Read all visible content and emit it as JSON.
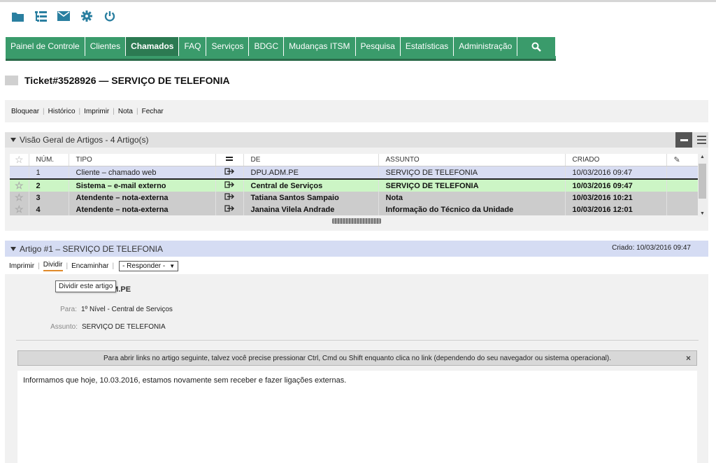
{
  "top_icons": [
    "folder-icon",
    "tree-list-icon",
    "envelope-icon",
    "gear-icon",
    "power-icon"
  ],
  "nav": {
    "items": [
      "Painel de Controle",
      "Clientes",
      "Chamados",
      "FAQ",
      "Serviços",
      "BDGC",
      "Mudanças ITSM",
      "Pesquisa",
      "Estatísticas",
      "Administração"
    ],
    "active": "Chamados",
    "search_icon": "search-icon"
  },
  "ticket": {
    "title": "Ticket#3528926 — SERVIÇO DE TELEFONIA"
  },
  "actions": [
    "Bloquear",
    "Histórico",
    "Imprimir",
    "Nota",
    "Fechar"
  ],
  "overview": {
    "title": "Visão Geral de Artigos - 4 Artigo(s)",
    "columns": [
      "NÚM.",
      "TIPO",
      "DE",
      "ASSUNTO",
      "CRIADO"
    ],
    "rows": [
      {
        "num": "1",
        "tipo": "Cliente – chamado web",
        "de": "DPU.ADM.PE",
        "assunto": "SERVIÇO DE TELEFONIA",
        "criado": "10/03/2016 09:47"
      },
      {
        "num": "2",
        "tipo": "Sistema – e-mail externo",
        "de": "Central de Serviços",
        "assunto": "SERVIÇO DE TELEFONIA",
        "criado": "10/03/2016 09:47"
      },
      {
        "num": "3",
        "tipo": "Atendente – nota-externa",
        "de": "Tatiana Santos Sampaio",
        "assunto": "Nota",
        "criado": "10/03/2016 10:21"
      },
      {
        "num": "4",
        "tipo": "Atendente – nota-externa",
        "de": "Janaina Vilela Andrade",
        "assunto": "Informação do Técnico da Unidade",
        "criado": "10/03/2016 12:01"
      }
    ]
  },
  "article": {
    "title": "Artigo #1 – SERVIÇO DE TELEFONIA",
    "created": "Criado: 10/03/2016 09:47",
    "actions": [
      "Imprimir",
      "Dividir",
      "Encaminhar"
    ],
    "reply_select": "- Responder -",
    "tooltip": "Dividir este artigo",
    "obscured_value": "DPU.ADM.PE",
    "to_label": "Para:",
    "to_value": "1º Nível - Central de Serviços",
    "subject_label": "Assunto:",
    "subject_value": "SERVIÇO DE TELEFONIA",
    "notice": "Para abrir links no artigo seguinte, talvez você precise pressionar Ctrl, Cmd ou Shift enquanto clica no link (dependendo do seu navegador ou sistema operacional).",
    "body": "Informamos que hoje, 10.03.2016, estamos novamente sem receber e fazer ligações externas."
  },
  "colors": {
    "nav_bg": "#3a9b6b",
    "row_selected": "#d8ddf2",
    "row_new": "#ccf5c5",
    "row_grey": "#cccccc",
    "article_header": "#d5dcf3"
  }
}
